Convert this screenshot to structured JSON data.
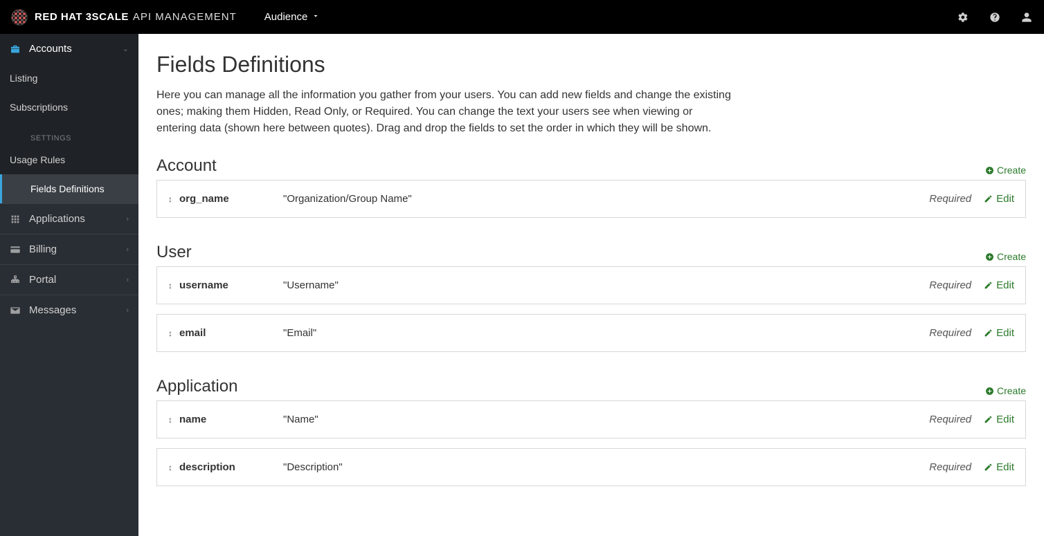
{
  "header": {
    "brand_main": "RED HAT 3SCALE",
    "brand_sub": "API MANAGEMENT",
    "context_menu": "Audience"
  },
  "sidebar": {
    "items": [
      {
        "label": "Accounts",
        "icon": "briefcase",
        "expanded": true
      },
      {
        "label": "Applications",
        "icon": "grid",
        "expanded": false
      },
      {
        "label": "Billing",
        "icon": "card",
        "expanded": false
      },
      {
        "label": "Portal",
        "icon": "sitemap",
        "expanded": false
      },
      {
        "label": "Messages",
        "icon": "mail",
        "expanded": false
      }
    ],
    "accounts_sub": {
      "listing": "Listing",
      "subscriptions": "Subscriptions",
      "settings_heading": "Settings",
      "usage_rules": "Usage Rules",
      "fields_definitions": "Fields Definitions"
    }
  },
  "main": {
    "title": "Fields Definitions",
    "description": "Here you can manage all the information you gather from your users. You can add new fields and change the existing ones; making them Hidden, Read Only, or Required. You can change the text your users see when viewing or entering data (shown here between quotes). Drag and drop the fields to set the order in which they will be shown.",
    "create_label": "Create",
    "edit_label": "Edit",
    "required_label": "Required",
    "sections": [
      {
        "title": "Account",
        "fields": [
          {
            "name": "org_name",
            "label": "\"Organization/Group Name\"",
            "status": "Required"
          }
        ]
      },
      {
        "title": "User",
        "fields": [
          {
            "name": "username",
            "label": "\"Username\"",
            "status": "Required"
          },
          {
            "name": "email",
            "label": "\"Email\"",
            "status": "Required"
          }
        ]
      },
      {
        "title": "Application",
        "fields": [
          {
            "name": "name",
            "label": "\"Name\"",
            "status": "Required"
          },
          {
            "name": "description",
            "label": "\"Description\"",
            "status": "Required"
          }
        ]
      }
    ]
  }
}
